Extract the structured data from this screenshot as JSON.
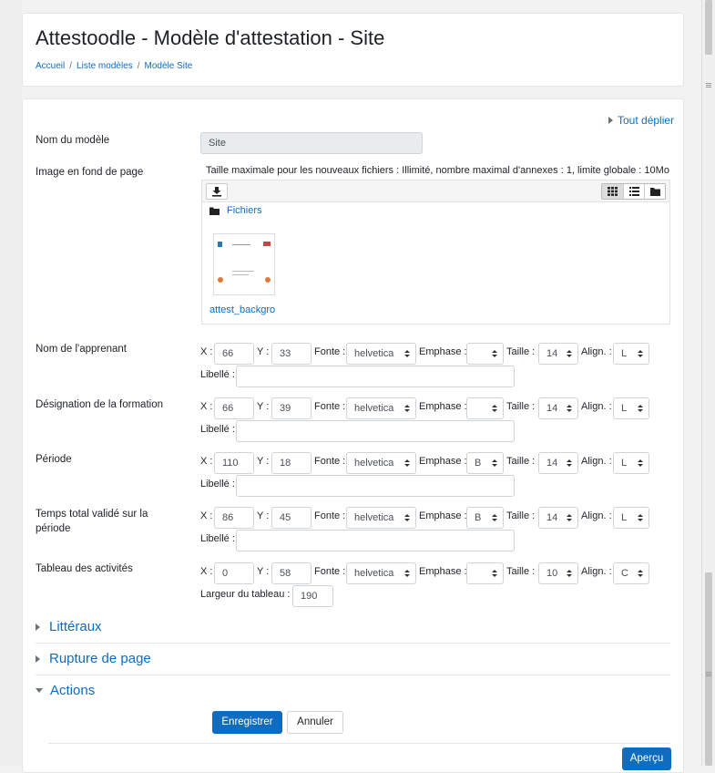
{
  "header": {
    "title": "Attestoodle - Modèle d'attestation - Site",
    "breadcrumb": [
      "Accueil",
      "Liste modèles",
      "Modèle Site"
    ]
  },
  "expand_all": "Tout déplier",
  "form": {
    "model_name_label": "Nom du modèle",
    "model_name_value": "Site",
    "background_label": "Image en fond de page",
    "file_info": "Taille maximale pour les nouveaux fichiers : Illimité, nombre maximal d'annexes : 1, limite globale : 10Mo",
    "files_folder": "Fichiers",
    "file_name": "attest_backgro",
    "common_labels": {
      "x": "X :",
      "y": "Y :",
      "font": "Fonte :",
      "emphasis": "Emphase :",
      "size": "Taille :",
      "align": "Align. :",
      "caption": "Libellé :"
    },
    "rows": [
      {
        "label": "Nom de l'apprenant",
        "x": "66",
        "y": "33",
        "font": "helvetica",
        "emphasis": "",
        "size": "14",
        "align": "L"
      },
      {
        "label": "Désignation de la formation",
        "x": "66",
        "y": "39",
        "font": "helvetica",
        "emphasis": "",
        "size": "14",
        "align": "L"
      },
      {
        "label": "Période",
        "x": "110",
        "y": "18",
        "font": "helvetica",
        "emphasis": "B",
        "size": "14",
        "align": "L"
      },
      {
        "label": "Temps total validé sur la période",
        "x": "86",
        "y": "45",
        "font": "helvetica",
        "emphasis": "B",
        "size": "14",
        "align": "L"
      },
      {
        "label": "Tableau des activités",
        "x": "0",
        "y": "58",
        "font": "helvetica",
        "emphasis": "",
        "size": "10",
        "align": "C"
      }
    ],
    "table_width_label": "Largeur du tableau :",
    "table_width_value": "190"
  },
  "sections": {
    "literals": "Littéraux",
    "page_break": "Rupture de page",
    "actions": "Actions"
  },
  "buttons": {
    "save": "Enregistrer",
    "cancel": "Annuler",
    "preview": "Aperçu"
  },
  "colors": {
    "link": "#0f6cbf",
    "primary": "#0f6cbf",
    "page_bg": "#f2f2f2"
  }
}
